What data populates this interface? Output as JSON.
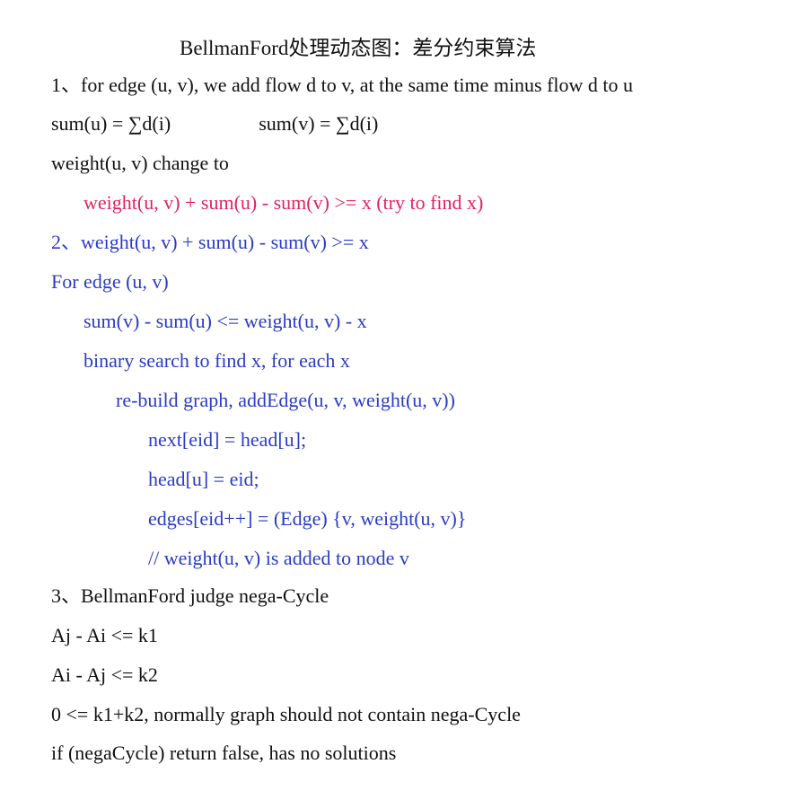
{
  "doc": {
    "title": "BellmanFord处理动态图：差分约束算法",
    "colors": {
      "text": "#111111",
      "blue": "#2a3bc7",
      "red": "#e0245e",
      "background": "#ffffff"
    },
    "lines": {
      "l1": "1、for edge (u, v), we add flow d to v, at the same time minus flow d to u",
      "l2a": "sum(u) = ∑d(i)",
      "l2b": "sum(v) = ∑d(i)",
      "l3": "weight(u, v)  change to",
      "l4": "weight(u, v) + sum(u) - sum(v) >= x (try to find x)",
      "l5": "2、weight(u, v) + sum(u) - sum(v) >= x",
      "l6": "For edge (u, v)",
      "l7": "sum(v) - sum(u) <= weight(u, v) - x",
      "l8": "binary search to find x, for each x",
      "l9": "re-build graph, addEdge(u, v, weight(u, v))",
      "l10": "next[eid] = head[u];",
      "l11": "head[u] = eid;",
      "l12": "edges[eid++] = (Edge) {v, weight(u, v)}",
      "l13": "// weight(u, v) is added to node v",
      "l14": "3、BellmanFord judge nega-Cycle",
      "l15": "Aj - Ai <= k1",
      "l16": "Ai - Aj <= k2",
      "l17": "0 <= k1+k2, normally graph should not contain nega-Cycle",
      "l18": "if (negaCycle) return false, has no solutions"
    }
  }
}
